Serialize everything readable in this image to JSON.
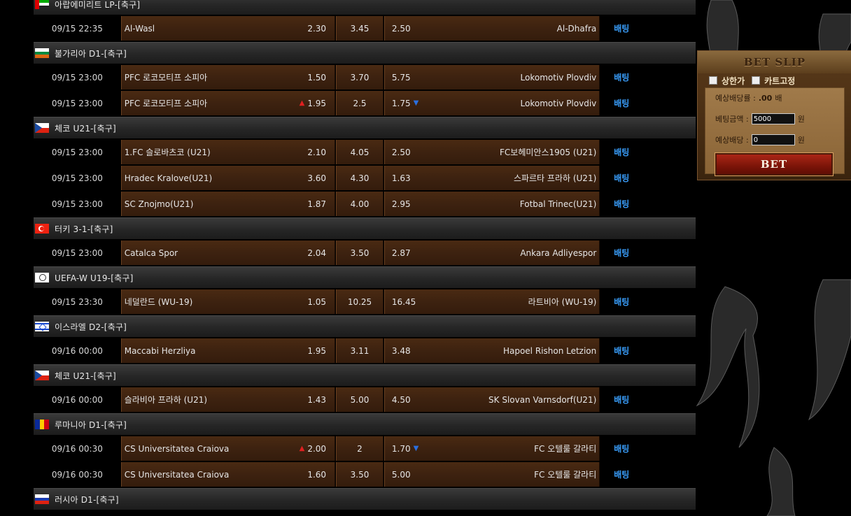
{
  "sections": [
    {
      "league": "아랍에미리트 LP-[축구]",
      "flag": "uae-flag-icon",
      "matches": [
        {
          "time": "09/15 22:35",
          "home": "Al-Wasl",
          "home_odds": "2.30",
          "draw": "3.45",
          "away_odds": "2.50",
          "away": "Al-Dhafra",
          "bet": "배팅",
          "home_arrow": "",
          "away_arrow": ""
        }
      ]
    },
    {
      "league": "불가리아 D1-[축구]",
      "flag": "bulgaria-flag-icon",
      "matches": [
        {
          "time": "09/15 23:00",
          "home": "PFC 로코모티프 소피아",
          "home_odds": "1.50",
          "draw": "3.70",
          "away_odds": "5.75",
          "away": "Lokomotiv Plovdiv",
          "bet": "배팅",
          "home_arrow": "",
          "away_arrow": ""
        },
        {
          "time": "09/15 23:00",
          "home": "PFC 로코모티프 소피아",
          "home_odds": "1.95",
          "draw": "2.5",
          "away_odds": "1.75",
          "away": "Lokomotiv Plovdiv",
          "bet": "배팅",
          "home_arrow": "▲",
          "away_arrow": "▼"
        }
      ]
    },
    {
      "league": "체코 U21-[축구]",
      "flag": "czech-flag-icon",
      "matches": [
        {
          "time": "09/15 23:00",
          "home": "1.FC 슬로바츠코 (U21)",
          "home_odds": "2.10",
          "draw": "4.05",
          "away_odds": "2.50",
          "away": "FC보헤미안스1905 (U21)",
          "bet": "배팅",
          "home_arrow": "",
          "away_arrow": ""
        },
        {
          "time": "09/15 23:00",
          "home": "Hradec Kralove(U21)",
          "home_odds": "3.60",
          "draw": "4.30",
          "away_odds": "1.63",
          "away": "스파르타 프라하 (U21)",
          "bet": "배팅",
          "home_arrow": "",
          "away_arrow": ""
        },
        {
          "time": "09/15 23:00",
          "home": "SC Znojmo(U21)",
          "home_odds": "1.87",
          "draw": "4.00",
          "away_odds": "2.95",
          "away": "Fotbal Trinec(U21)",
          "bet": "배팅",
          "home_arrow": "",
          "away_arrow": ""
        }
      ]
    },
    {
      "league": "터키 3-1-[축구]",
      "flag": "turkey-flag-icon",
      "matches": [
        {
          "time": "09/15 23:00",
          "home": "Catalca Spor",
          "home_odds": "2.04",
          "draw": "3.50",
          "away_odds": "2.87",
          "away": "Ankara Adliyespor",
          "bet": "배팅",
          "home_arrow": "",
          "away_arrow": ""
        }
      ]
    },
    {
      "league": "UEFA-W U19-[축구]",
      "flag": "uefa-logo-icon",
      "matches": [
        {
          "time": "09/15 23:30",
          "home": "네덜란드 (WU-19)",
          "home_odds": "1.05",
          "draw": "10.25",
          "away_odds": "16.45",
          "away": "라트비아 (WU-19)",
          "bet": "배팅",
          "home_arrow": "",
          "away_arrow": ""
        }
      ]
    },
    {
      "league": "이스라엘 D2-[축구]",
      "flag": "israel-flag-icon",
      "matches": [
        {
          "time": "09/16 00:00",
          "home": "Maccabi Herzliya",
          "home_odds": "1.95",
          "draw": "3.11",
          "away_odds": "3.48",
          "away": "Hapoel Rishon Letzion",
          "bet": "배팅",
          "home_arrow": "",
          "away_arrow": ""
        }
      ]
    },
    {
      "league": "체코 U21-[축구]",
      "flag": "czech-flag-icon",
      "matches": [
        {
          "time": "09/16 00:00",
          "home": "슬라비아 프라하 (U21)",
          "home_odds": "1.43",
          "draw": "5.00",
          "away_odds": "4.50",
          "away": "SK Slovan Varnsdorf(U21)",
          "bet": "배팅",
          "home_arrow": "",
          "away_arrow": ""
        }
      ]
    },
    {
      "league": "루마니아 D1-[축구]",
      "flag": "romania-flag-icon",
      "matches": [
        {
          "time": "09/16 00:30",
          "home": "CS Universitatea Craiova",
          "home_odds": "2.00",
          "draw": "2",
          "away_odds": "1.70",
          "away": "FC 오텔룰 갈라티",
          "bet": "배팅",
          "home_arrow": "▲",
          "away_arrow": "▼"
        },
        {
          "time": "09/16 00:30",
          "home": "CS Universitatea Craiova",
          "home_odds": "1.60",
          "draw": "3.50",
          "away_odds": "5.00",
          "away": "FC 오텔룰 갈라티",
          "bet": "배팅",
          "home_arrow": "",
          "away_arrow": ""
        }
      ]
    },
    {
      "league": "러시아 D1-[축구]",
      "flag": "russia-flag-icon",
      "matches": []
    }
  ],
  "betslip": {
    "title": "BET SLIP",
    "opt_max": "상한가",
    "opt_cart": "카트고정",
    "expected_rate_label": "예상배당률 :",
    "expected_rate_value": ".00",
    "expected_rate_unit": "배",
    "amount_label": "베팅금액 :",
    "amount_value": "5000",
    "amount_unit": "원",
    "payout_label": "예상배당 :",
    "payout_value": "0",
    "payout_unit": "원",
    "bet_button": "BET"
  },
  "colors": {
    "bet_link": "#3aa0ff",
    "odds_cell": "#3d2210",
    "up_arrow": "#e02020",
    "down_arrow": "#2a6fe0"
  }
}
